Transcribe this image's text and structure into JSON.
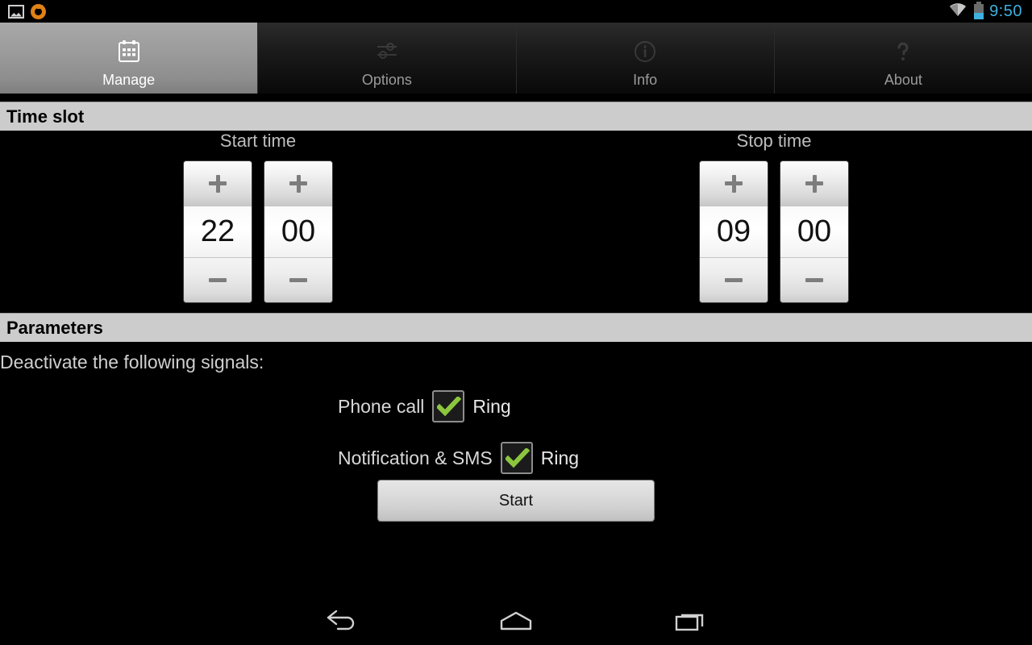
{
  "statusbar": {
    "left_icons": [
      {
        "name": "gallery-icon",
        "label": "Screenshot"
      },
      {
        "name": "update-icon",
        "label": "Update"
      }
    ],
    "wifi_icon": "wifi-icon",
    "battery_icon": "battery-icon",
    "clock": "9:50",
    "clock_color": "#3fb0dd"
  },
  "tabs": [
    {
      "label": "Manage",
      "icon": "calendar-icon",
      "active": true
    },
    {
      "label": "Options",
      "icon": "sliders-icon",
      "active": false
    },
    {
      "label": "Info",
      "icon": "info-circle-icon",
      "active": false
    },
    {
      "label": "About",
      "icon": "question-mark-icon",
      "active": false
    }
  ],
  "sections": {
    "timeslot_title": "Time slot",
    "parameters_title": "Parameters"
  },
  "timeslot": {
    "start": {
      "title": "Start time",
      "hour": "22",
      "minute": "00",
      "increment_label": "+",
      "decrement_label": "−"
    },
    "stop": {
      "title": "Stop time",
      "hour": "09",
      "minute": "00",
      "increment_label": "+",
      "decrement_label": "−"
    }
  },
  "parameters": {
    "deactivate_label": "Deactivate the following signals:",
    "signals": [
      {
        "name": "Phone call",
        "checkbox_label": "Ring",
        "checked": true
      },
      {
        "name": "Notification & SMS",
        "checkbox_label": "Ring",
        "checked": true
      }
    ],
    "checkbox_check_color": "#8cc63e",
    "start_button": "Start"
  },
  "navbar": {
    "back": "back-icon",
    "home": "home-icon",
    "recents": "recent-apps-icon"
  }
}
